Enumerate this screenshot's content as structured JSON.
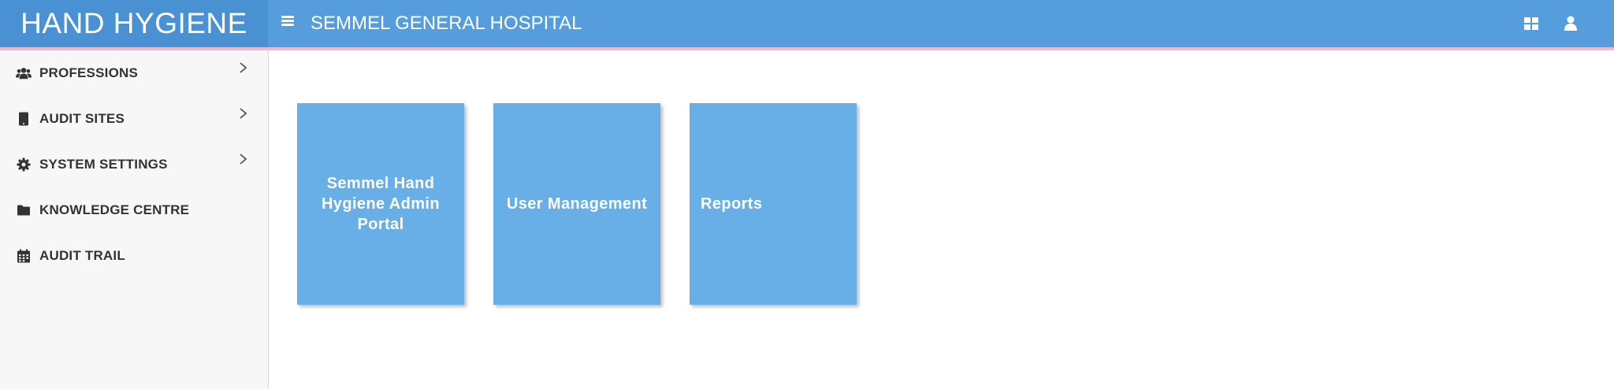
{
  "header": {
    "brand": "HAND HYGIENE",
    "hospital_name": "SEMMEL GENERAL HOSPITAL",
    "menu_icon": "hamburger-icon",
    "apps_icon": "grid-icon",
    "user_icon": "user-icon"
  },
  "sidebar": {
    "items": [
      {
        "label": "PROFESSIONS",
        "icon": "users-icon",
        "has_submenu": true
      },
      {
        "label": "AUDIT SITES",
        "icon": "tablet-icon",
        "has_submenu": true
      },
      {
        "label": "SYSTEM SETTINGS",
        "icon": "gear-icon",
        "has_submenu": true
      },
      {
        "label": "KNOWLEDGE CENTRE",
        "icon": "folder-icon",
        "has_submenu": false
      },
      {
        "label": "AUDIT TRAIL",
        "icon": "calendar-icon",
        "has_submenu": false
      }
    ]
  },
  "main": {
    "tiles": [
      {
        "label": "Semmel Hand Hygiene Admin Portal"
      },
      {
        "label": "User Management"
      },
      {
        "label": "Reports"
      }
    ]
  },
  "colors": {
    "header_bg": "#559ddc",
    "brand_bg": "#4a91d4",
    "header_border": "#f3b6cc",
    "sidebar_bg": "#f7f7f7",
    "tile_bg": "#68aee7"
  }
}
